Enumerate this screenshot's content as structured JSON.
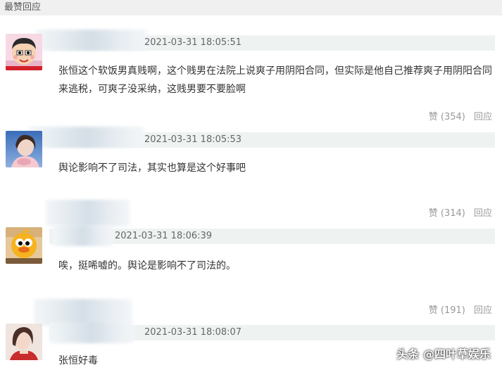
{
  "section_title": "最赞回应",
  "comments": [
    {
      "timestamp": "2021-03-31 18:05:51",
      "text": "张恒这个软饭男真贱啊，这个贱男在法院上说爽子用阴阳合同，但实际是他自己推荐爽子用阴阳合同来逃税，可爽子没采纳，这贱男要不要脸啊",
      "likes": "赞 (354)",
      "reply": "回应",
      "avatar_icon": "cartoon-avatar"
    },
    {
      "timestamp": "2021-03-31 18:05:53",
      "text": "舆论影响不了司法，其实也算是这个好事吧",
      "likes": "赞 (314)",
      "reply": "回应",
      "avatar_icon": "photo-avatar"
    },
    {
      "timestamp": "2021-03-31 18:06:39",
      "text": "唉，挺唏嘘的。舆论是影响不了司法的。",
      "likes": "赞 (191)",
      "reply": "回应",
      "avatar_icon": "duck-avatar"
    },
    {
      "timestamp": "2021-03-31 18:08:07",
      "text": "张恒好毒",
      "likes": "",
      "reply": "",
      "avatar_icon": "photo-avatar"
    }
  ],
  "watermark": "头条 @四叶草娱乐"
}
